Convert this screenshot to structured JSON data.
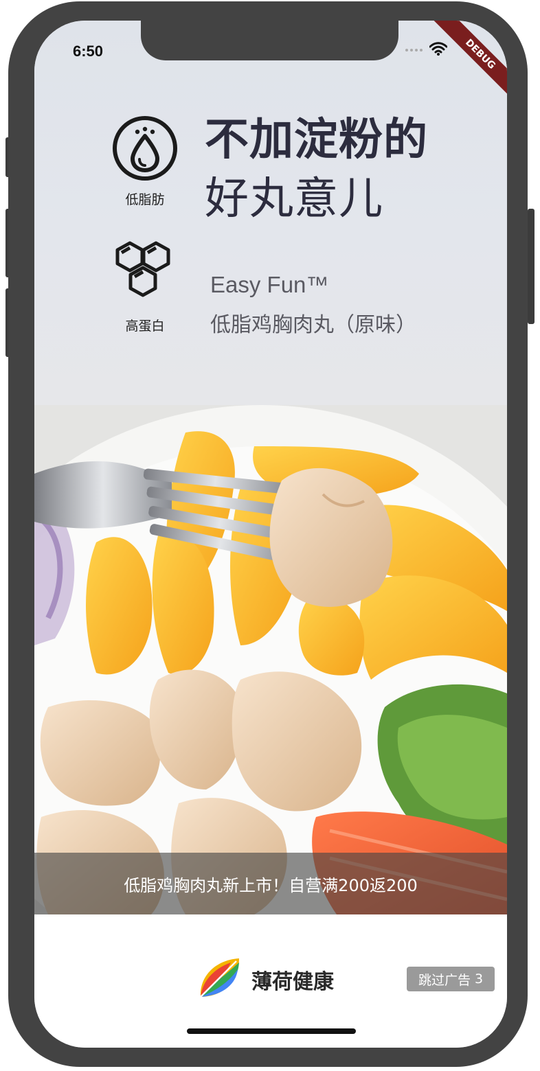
{
  "status_bar": {
    "time": "6:50",
    "debug_label": "DEBUG"
  },
  "ad": {
    "features": [
      {
        "label": "低脂肪",
        "icon": "water-drop-icon"
      },
      {
        "label": "高蛋白",
        "icon": "molecule-icon"
      }
    ],
    "headline_line1": "不加淀粉的",
    "headline_line2": "好丸意儿",
    "brand_en": "Easy Fun™",
    "product_name": "低脂鸡胸肉丸（原味）",
    "caption": "低脂鸡胸肉丸新上市！自营满200返200"
  },
  "footer": {
    "app_name": "薄荷健康",
    "skip_label": "跳过广告",
    "countdown": "3"
  },
  "colors": {
    "headline": "#2c2c3e",
    "caption_bar": "rgba(70,70,70,0.62)",
    "skip_button": "#9a9a9a",
    "debug_ribbon": "#7a1e1e"
  }
}
